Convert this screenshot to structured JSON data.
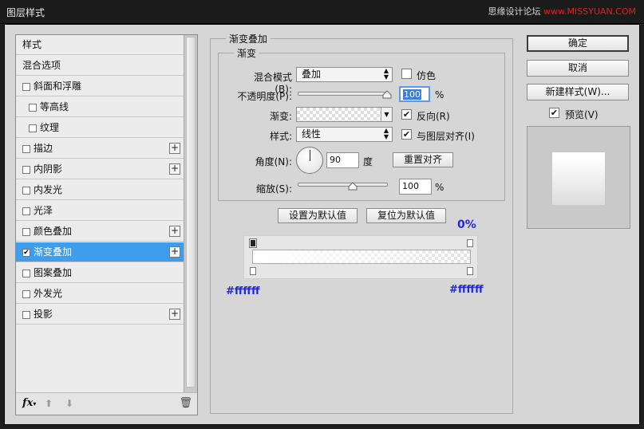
{
  "window": {
    "title": "图层样式",
    "watermark_a": "思缘设计论坛",
    "watermark_b": "www.MISSYUAN.COM"
  },
  "style_list": {
    "header": "样式",
    "items": [
      {
        "label": "混合选项",
        "checkbox": false,
        "plus": false,
        "indent": 0
      },
      {
        "label": "斜面和浮雕",
        "checkbox": true,
        "plus": false,
        "indent": 0
      },
      {
        "label": "等高线",
        "checkbox": true,
        "plus": false,
        "indent": 1
      },
      {
        "label": "纹理",
        "checkbox": true,
        "plus": false,
        "indent": 1
      },
      {
        "label": "描边",
        "checkbox": true,
        "plus": true,
        "indent": 0
      },
      {
        "label": "内阴影",
        "checkbox": true,
        "plus": true,
        "indent": 0
      },
      {
        "label": "内发光",
        "checkbox": true,
        "plus": false,
        "indent": 0
      },
      {
        "label": "光泽",
        "checkbox": true,
        "plus": false,
        "indent": 0
      },
      {
        "label": "颜色叠加",
        "checkbox": true,
        "plus": true,
        "indent": 0
      },
      {
        "label": "渐变叠加",
        "checkbox": true,
        "plus": true,
        "indent": 0,
        "selected": true,
        "checked": true
      },
      {
        "label": "图案叠加",
        "checkbox": true,
        "plus": false,
        "indent": 0
      },
      {
        "label": "外发光",
        "checkbox": true,
        "plus": false,
        "indent": 0
      },
      {
        "label": "投影",
        "checkbox": true,
        "plus": true,
        "indent": 0
      }
    ],
    "footer": {
      "fx": "fx",
      "fx_caret": "▾",
      "up": "⬆",
      "down": "⬇",
      "trash": "🗑"
    }
  },
  "panel": {
    "group_title": "渐变叠加",
    "inner_title": "渐变",
    "blend_mode": {
      "label": "混合模式(B):",
      "value": "叠加",
      "dither_label": "仿色",
      "dither_checked": false
    },
    "opacity": {
      "label": "不透明度(P):",
      "value": "100",
      "unit": "%",
      "percent": 100
    },
    "gradient": {
      "label": "渐变:",
      "reverse_label": "反向(R)",
      "reverse_checked": true
    },
    "style": {
      "label": "样式:",
      "value": "线性",
      "align_label": "与图层对齐(I)",
      "align_checked": true
    },
    "angle": {
      "label": "角度(N):",
      "value": "90",
      "unit": "度",
      "reset_label": "重置对齐"
    },
    "scale": {
      "label": "缩放(S):",
      "value": "100",
      "unit": "%",
      "percent": 100
    },
    "make_default": "设置为默认值",
    "reset_default": "复位为默认值"
  },
  "gradient_editor": {
    "opacity_end_label": "0%",
    "left_color": "#ffffff",
    "right_color": "#ffffff",
    "stops": [
      {
        "opacity": 100,
        "color": "#ffffff"
      },
      {
        "opacity": 0,
        "color": "#ffffff"
      }
    ]
  },
  "buttons": {
    "ok": "确定",
    "cancel": "取消",
    "new_style": "新建样式(W)...",
    "preview_label": "预览(V)",
    "preview_checked": true
  }
}
